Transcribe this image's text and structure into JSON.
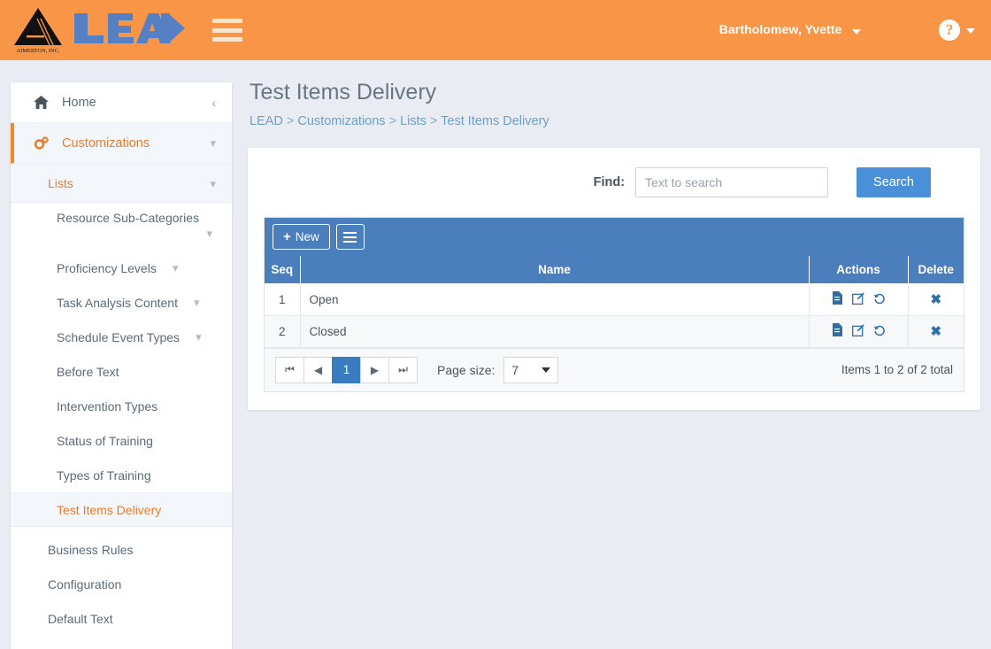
{
  "header": {
    "logo_company": "AIMERTON, INC.",
    "logo_word": "LEAD",
    "menu_icon": "hamburger-icon",
    "user_name": "Bartholomew, Yvette",
    "help_icon": "question-mark-icon"
  },
  "sidebar": {
    "home": {
      "label": "Home",
      "icon": "home-icon",
      "collapse_icon": "chevron-left-icon"
    },
    "customizations": {
      "label": "Customizations",
      "icon": "gears-icon",
      "chevron": "chevron-down-icon"
    },
    "lists": {
      "label": "Lists",
      "chevron": "chevron-down-icon"
    },
    "list_items": [
      {
        "label": "Resource Sub-Categories",
        "chevron": "chevron-down-icon",
        "selected": false
      },
      {
        "label": "Proficiency Levels",
        "chevron": "chevron-down-icon",
        "selected": false
      },
      {
        "label": "Task Analysis Content",
        "chevron": "chevron-down-icon",
        "selected": false
      },
      {
        "label": "Schedule Event Types",
        "chevron": "chevron-down-icon",
        "selected": false
      },
      {
        "label": "Before Text",
        "chevron": "",
        "selected": false
      },
      {
        "label": "Intervention Types",
        "chevron": "",
        "selected": false
      },
      {
        "label": "Status of Training",
        "chevron": "",
        "selected": false
      },
      {
        "label": "Types of Training",
        "chevron": "",
        "selected": false
      },
      {
        "label": "Test Items Delivery",
        "chevron": "",
        "selected": true
      }
    ],
    "bottom_items": [
      {
        "label": "Business Rules"
      },
      {
        "label": "Configuration"
      },
      {
        "label": "Default Text"
      }
    ]
  },
  "main": {
    "title": "Test Items Delivery",
    "breadcrumb": "LEAD > Customizations > Lists > Test Items Delivery",
    "breadcrumb_parts": [
      "LEAD",
      "Customizations",
      "Lists",
      "Test Items Delivery"
    ],
    "find_label": "Find:",
    "find_placeholder": "Text to search",
    "find_value": "",
    "search_label": "Search"
  },
  "grid": {
    "new_label": "New",
    "new_plus": "+",
    "menu_icon": "hamburger-icon",
    "columns": [
      "Seq",
      "Name",
      "Actions",
      "Delete"
    ],
    "rows": [
      {
        "seq": "1",
        "name": "Open"
      },
      {
        "seq": "2",
        "name": "Closed"
      }
    ],
    "row_action_icons": [
      "document-icon",
      "edit-icon",
      "history-icon"
    ],
    "delete_icon": "close-x-icon",
    "pager": {
      "first": "⏮",
      "prev": "◀",
      "current": "1",
      "next": "▶",
      "last": "⏭"
    },
    "page_size_label": "Page size:",
    "page_size_value": "7",
    "totals": "Items 1 to 2 of 2 total"
  },
  "colors": {
    "header_orange": "#f99546",
    "accent_orange": "#ec7c2a",
    "grid_blue": "#4b7ebd",
    "button_blue": "#4a90d9",
    "page_bg": "#e9edf3"
  }
}
